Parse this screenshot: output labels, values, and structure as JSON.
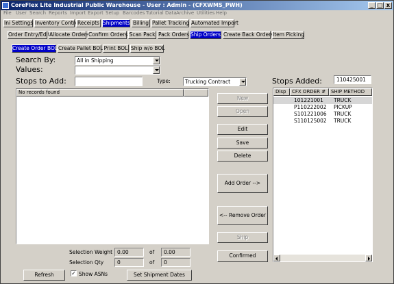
{
  "window": {
    "title": "CoreFlex Lite Industrial Public Warehouse - User : Admin - (CFXWMS_PWH)",
    "controls": {
      "minimize": "_",
      "maximize": "□",
      "close": "x"
    }
  },
  "menu": [
    "File",
    "User",
    "Search",
    "Reports",
    "Import",
    "Export",
    "Setup",
    "Barcodes",
    "Tutorial Data",
    "Archive",
    "Utilities",
    "Help"
  ],
  "main_tabs": [
    "Ini Settings",
    "Inventory Control",
    "Receipts",
    "Shipments",
    "Billing",
    "Pallet Tracking",
    "Automated Import"
  ],
  "sub_tabs": [
    "Order Entry/Edit",
    "Allocate Orders",
    "Confirm Orders",
    "Scan Pack",
    "Pack Orders",
    "Ship Orders",
    "Create Back Orders",
    "Item Picking"
  ],
  "bol_tabs": [
    "Create Order BOL",
    "Create Pallet BOL",
    "Print BOL",
    "Ship w/o BOL"
  ],
  "search": {
    "search_by_label": "Search By:",
    "search_by_value": "All in Shipping",
    "values_label": "Values:",
    "values_value": ""
  },
  "stops_to_add": {
    "label": "Stops to Add:",
    "input_value": "",
    "type_label": "Type:",
    "type_value": "Trucking Contract",
    "empty_message": "No records found"
  },
  "stops_added": {
    "label": "Stops Added:",
    "id_value": "110425001",
    "columns": [
      "Disp",
      "CFX ORDER #",
      "SHIP METHOD"
    ],
    "rows": [
      {
        "disp": "",
        "order": "101221001",
        "method": "TRUCK"
      },
      {
        "disp": "",
        "order": "P110222002",
        "method": "PICKUP"
      },
      {
        "disp": "",
        "order": "S101221006",
        "method": "TRUCK"
      },
      {
        "disp": "",
        "order": "S110125002",
        "method": "TRUCK"
      }
    ]
  },
  "buttons": {
    "new": "New",
    "open": "Open",
    "edit": "Edit",
    "save": "Save",
    "delete": "Delete",
    "add_order": "Add Order -->",
    "remove_order": "<-- Remove Order",
    "ship": "Ship",
    "confirmed": "Confirmed",
    "refresh": "Refresh",
    "set_shipment_dates": "Set Shipment Dates"
  },
  "selection": {
    "weight_label": "Selection Weight",
    "weight_value": "0.00",
    "weight_of": "of",
    "weight_total": "0.00",
    "qty_label": "Selection Qty",
    "qty_value": "0",
    "qty_of": "of",
    "qty_total": "0"
  },
  "show_asns": {
    "label": "Show ASNs",
    "checked": "✓"
  }
}
